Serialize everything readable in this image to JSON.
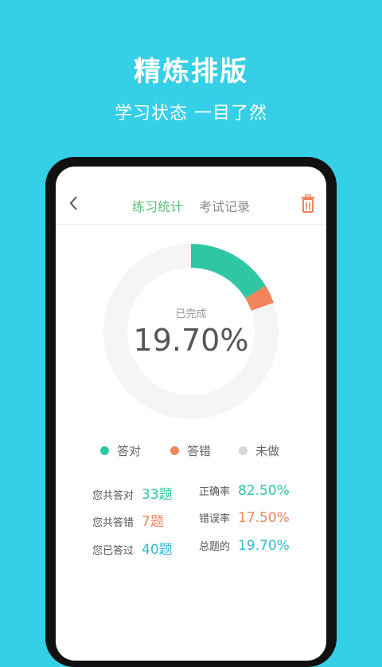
{
  "promo": {
    "title": "精炼排版",
    "subtitle": "学习状态 一目了然"
  },
  "header": {
    "tabs": [
      {
        "label": "练习统计",
        "active": true
      },
      {
        "label": "考试记录",
        "active": false
      }
    ],
    "back_icon": "chevron-left-icon",
    "delete_icon": "trash-icon"
  },
  "summary": {
    "label": "已完成",
    "value": "19.70%"
  },
  "chart_data": {
    "type": "pie",
    "categories": [
      "答对",
      "答错",
      "未做"
    ],
    "values": [
      16.25,
      3.45,
      80.3
    ],
    "colors": [
      "#2fc7a3",
      "#f0845c",
      "#f5f5f5"
    ]
  },
  "legend": [
    {
      "label": "答对",
      "color": "#2fc7a3"
    },
    {
      "label": "答错",
      "color": "#f0845c"
    },
    {
      "label": "未做",
      "color": "#d8d8d8"
    }
  ],
  "stats": {
    "correct": {
      "label": "您共答对",
      "value": "33题"
    },
    "wrong": {
      "label": "您共答错",
      "value": "7题"
    },
    "done": {
      "label": "您已答过",
      "value": "40题"
    },
    "accuracy": {
      "label": "正确率",
      "value": "82.50%"
    },
    "error_rate": {
      "label": "错误率",
      "value": "17.50%"
    },
    "overall": {
      "label": "总题的",
      "value": "19.70%"
    }
  }
}
